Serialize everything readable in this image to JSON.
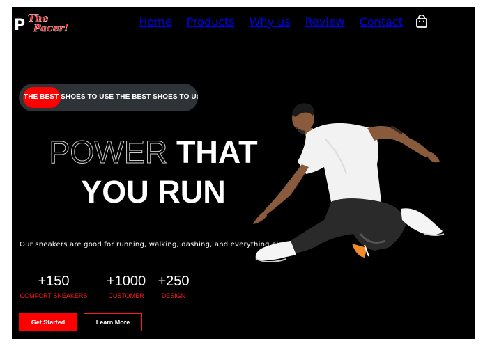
{
  "logo": {
    "letter": "P",
    "line1": "The",
    "line2": "Pacer!"
  },
  "nav": {
    "items": [
      "Home",
      "Products",
      "Why us",
      "Review",
      "Contact"
    ],
    "cart_icon": "shopping-bag-icon"
  },
  "hero": {
    "badge_text": "THE BEST SHOES TO USE THE BEST SHOES TO USE",
    "headline_outline": "POWER",
    "headline_rest": " THAT",
    "headline_line2": "YOU RUN",
    "tagline": "Our sneakers are good for running, walking, dashing, and everything el...."
  },
  "stats": [
    {
      "value": "+150",
      "label": "COMFORT SNEAKERS"
    },
    {
      "value": "+1000",
      "label": "CUSTOMER"
    },
    {
      "value": "+250",
      "label": "DESIGN"
    }
  ],
  "buttons": {
    "primary": "Get Started",
    "secondary": "Learn More"
  },
  "colors": {
    "accent": "#ff0000",
    "background": "#000000",
    "badge_bg": "#2e3338"
  }
}
